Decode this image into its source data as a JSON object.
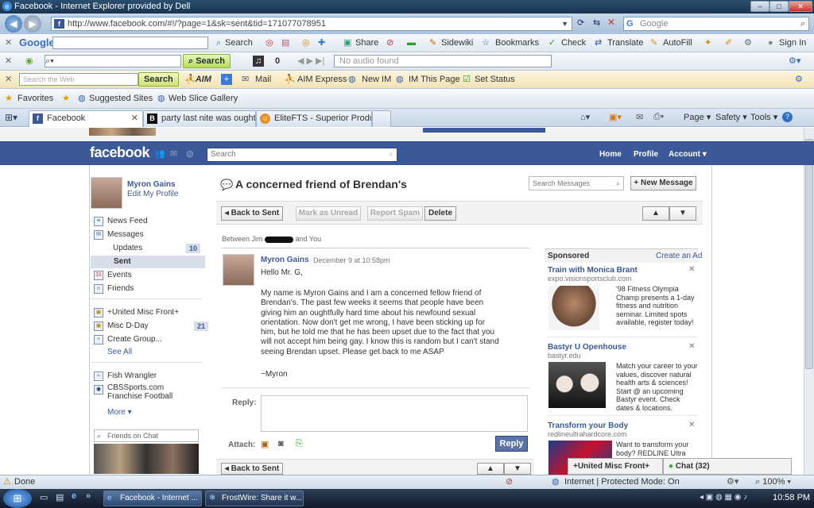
{
  "window": {
    "title": "Facebook - Internet Explorer provided by Dell",
    "url": "http://www.facebook.com/#!/?page=1&sk=sent&tid=171077078951",
    "search_placeholder": "Google"
  },
  "google_toolbar": {
    "brand": "Google",
    "items": [
      "Search",
      "Share",
      "Sidewiki",
      "Bookmarks",
      "Check",
      "Translate",
      "AutoFill",
      "Sign In"
    ]
  },
  "media_toolbar": {
    "search_label": "Search",
    "count": "0",
    "audio_status": "No audio found"
  },
  "aim_toolbar": {
    "search_placeholder": "Search the Web",
    "search_label": "Search",
    "aim_label": "AIM",
    "items": [
      "Mail",
      "AIM Express",
      "New IM",
      "IM This Page",
      "Set Status"
    ]
  },
  "favorites_bar": {
    "favorites": "Favorites",
    "suggested": "Suggested Sites",
    "webslice": "Web Slice Gallery"
  },
  "tabs": [
    {
      "label": "Facebook"
    },
    {
      "label": "party last nite was oughtfu..."
    },
    {
      "label": "EliteFTS - Superior Product..."
    }
  ],
  "command_bar": {
    "page": "Page",
    "safety": "Safety",
    "tools": "Tools"
  },
  "fb_header": {
    "logo": "facebook",
    "search_placeholder": "Search",
    "nav": [
      "Home",
      "Profile",
      "Account"
    ]
  },
  "profile": {
    "name": "Myron Gains",
    "edit": "Edit My Profile"
  },
  "left_nav": {
    "news_feed": "News Feed",
    "messages": "Messages",
    "updates": "Updates",
    "updates_count": "10",
    "sent": "Sent",
    "events": "Events",
    "friends": "Friends",
    "group1": "+United Misc Front+",
    "group2": "Misc D-Day",
    "group2_count": "21",
    "create_group": "Create Group...",
    "see_all": "See All",
    "app1": "Fish Wrangler",
    "app2": "CBSSports.com Franchise Football",
    "more": "More",
    "chat_search": "Friends on Chat"
  },
  "thread": {
    "title": "A concerned friend of Brendan's",
    "search_placeholder": "Search Messages",
    "new_message": "+ New Message",
    "back": "Back to Sent",
    "mark_unread": "Mark as Unread",
    "report_spam": "Report Spam",
    "delete": "Delete",
    "between_prefix": "Between Jim",
    "between_suffix": "and You"
  },
  "message": {
    "sender": "Myron Gains",
    "date": "December 9 at 10:58pm",
    "greeting": "Hello Mr. G,",
    "body": "My name is Myron Gains and I am a concerned fellow friend of Brendan's. The past few weeks it seems that people have been giving him an oughtfully hard time about his newfound sexual orientation. Now don't get me wrong, I have been sticking up for him, but he told me that he has been upset due to the fact that you will not accept him being gay. I know this is random but I can't stand seeing Brendan upset. Please get back to me ASAP",
    "signoff": "~Myron"
  },
  "reply": {
    "label": "Reply:",
    "attach": "Attach:",
    "button": "Reply"
  },
  "ads": {
    "header": "Sponsored",
    "create": "Create an Ad",
    "items": [
      {
        "title": "Train with Monica Brant",
        "url": "expo.visionsportsclub.com",
        "text": "'98 Fitness Olympia Champ presents a 1-day fitness and nutrition seminar. Limited spots available, register today!"
      },
      {
        "title": "Bastyr U Openhouse",
        "url": "bastyr.edu",
        "text": "Match your career to your values, discover natural health arts & sciences! Start @ an upcoming Bastyr event. Check dates & locations."
      },
      {
        "title": "Transform your Body",
        "url": "redlineultrahardcore.com",
        "text": "Want to transform your body? REDLINE Ultra"
      }
    ]
  },
  "chat_bar": {
    "group": "+United Misc Front+",
    "chat": "Chat (32)"
  },
  "status_bar": {
    "done": "Done",
    "zone": "Internet | Protected Mode: On",
    "zoom": "100%"
  },
  "taskbar": {
    "items": [
      "Facebook - Internet ...",
      "FrostWire: Share it w..."
    ],
    "clock": "10:58 PM"
  }
}
